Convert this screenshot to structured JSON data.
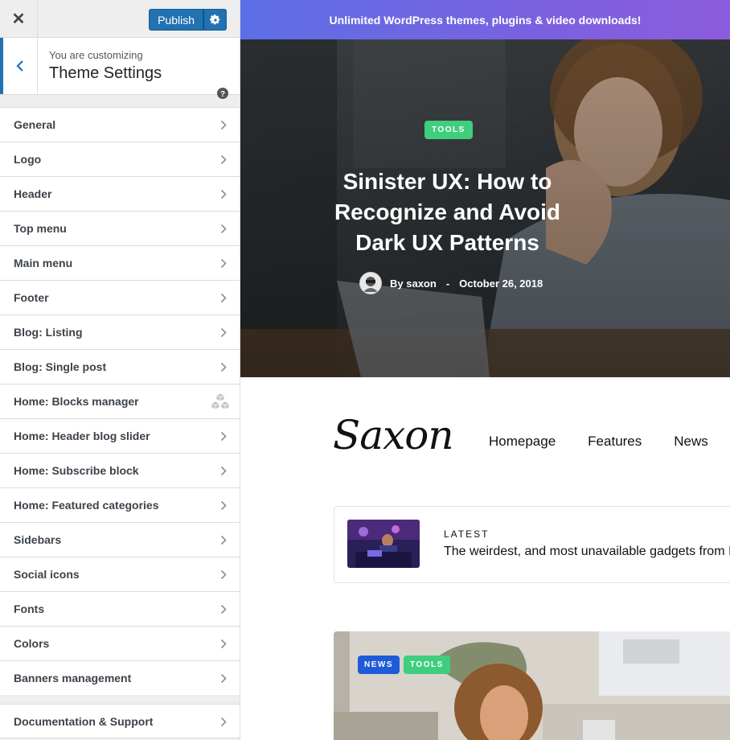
{
  "topbar": {
    "publish_label": "Publish"
  },
  "info": {
    "subtitle": "You are customizing",
    "title": "Theme Settings"
  },
  "sections": [
    {
      "label": "General"
    },
    {
      "label": "Logo"
    },
    {
      "label": "Header"
    },
    {
      "label": "Top menu"
    },
    {
      "label": "Main menu"
    },
    {
      "label": "Footer"
    },
    {
      "label": "Blog: Listing"
    },
    {
      "label": "Blog: Single post"
    },
    {
      "label": "Home: Blocks manager"
    },
    {
      "label": "Home: Header blog slider"
    },
    {
      "label": "Home: Subscribe block"
    },
    {
      "label": "Home: Featured categories"
    },
    {
      "label": "Sidebars"
    },
    {
      "label": "Social icons"
    },
    {
      "label": "Fonts"
    },
    {
      "label": "Colors"
    },
    {
      "label": "Banners management"
    }
  ],
  "doc_section": {
    "label": "Documentation & Support"
  },
  "preview": {
    "promo": "Unlimited WordPress themes, plugins & video downloads!",
    "hero": {
      "tag": "TOOLS",
      "title": "Sinister UX: How to Recognize and Avoid Dark UX Patterns",
      "author": "By saxon",
      "separator": "-",
      "date": "October 26, 2018"
    },
    "logo": "Saxon",
    "nav": [
      "Homepage",
      "Features",
      "News"
    ],
    "latest": {
      "kicker": "LATEST",
      "text": "The weirdest, and most unavailable gadgets from IF"
    },
    "card_tags": [
      {
        "label": "NEWS",
        "color": "#1e5bd8"
      },
      {
        "label": "TOOLS",
        "color": "#3fce7e"
      }
    ]
  },
  "colors": {
    "accent": "#2271b1",
    "promo_start": "#5d6fe6",
    "promo_end": "#8d5cde",
    "tag_green": "#3fce7e",
    "tag_blue": "#1e5bd8"
  }
}
